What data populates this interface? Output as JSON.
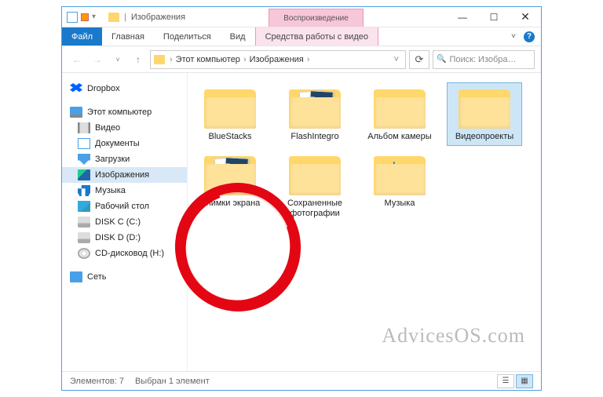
{
  "titlebar": {
    "title": "Изображения",
    "context_tab": "Воспроизведение",
    "minimize": "—",
    "maximize": "☐",
    "close": "✕"
  },
  "ribbon": {
    "file": "Файл",
    "tabs": [
      "Главная",
      "Поделиться",
      "Вид"
    ],
    "context_sub": "Средства работы с видео",
    "expand": "˅",
    "help": "?"
  },
  "addressbar": {
    "back": "←",
    "forward": "→",
    "recent": "˅",
    "up": "↑",
    "crumbs": [
      "Этот компьютер",
      "Изображения"
    ],
    "sep": "›",
    "dropdown": "˅",
    "refresh": "⟳"
  },
  "search": {
    "placeholder": "Поиск: Изобра…",
    "icon": "🔍"
  },
  "nav": {
    "dropbox": "Dropbox",
    "this_pc": "Этот компьютер",
    "children": [
      {
        "icon": "video",
        "label": "Видео"
      },
      {
        "icon": "docs",
        "label": "Документы"
      },
      {
        "icon": "download",
        "label": "Загрузки"
      },
      {
        "icon": "pics",
        "label": "Изображения",
        "selected": true
      },
      {
        "icon": "music",
        "label": "Музыка"
      },
      {
        "icon": "desktop",
        "label": "Рабочий стол"
      },
      {
        "icon": "drive",
        "label": "DISK C (C:)"
      },
      {
        "icon": "drive",
        "label": "DISK D (D:)"
      },
      {
        "icon": "cd",
        "label": "CD-дисковод (H:)"
      }
    ],
    "network": "Сеть"
  },
  "items": [
    {
      "label": "BlueStacks",
      "thumbs": 0
    },
    {
      "label": "FlashIntegro",
      "thumbs": 2
    },
    {
      "label": "Альбом камеры",
      "thumbs": 0
    },
    {
      "label": "Видеопроекты",
      "thumbs": 0,
      "selected": true
    },
    {
      "label": "Снимки экрана",
      "thumbs": 2,
      "circled": true
    },
    {
      "label": "Сохраненные фотографии",
      "thumbs": 0
    },
    {
      "label": "Музыка",
      "thumbs": 0,
      "music": true
    }
  ],
  "status": {
    "count": "Элементов: 7",
    "selection": "Выбран 1 элемент"
  },
  "watermark": "AdvicesOS.com"
}
